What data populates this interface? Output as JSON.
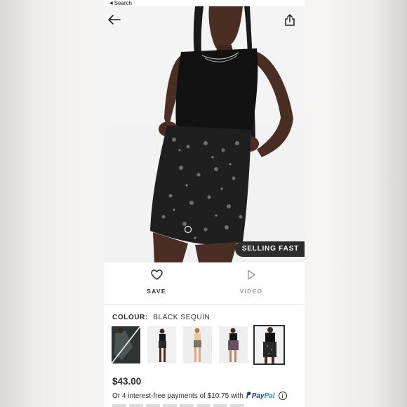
{
  "status": {
    "back_label": "Search",
    "back_icon": "triangle-left-icon"
  },
  "hero": {
    "badge": "SELLING FAST",
    "back_icon": "arrow-left-icon",
    "share_icon": "share-icon"
  },
  "actions": {
    "save_label": "SAVE",
    "save_icon": "heart-icon",
    "video_label": "VIDEO",
    "video_icon": "play-icon"
  },
  "colour": {
    "key": "COLOUR:",
    "value": "BLACK SEQUIN"
  },
  "thumbnails": [
    {
      "name": "thumb-1"
    },
    {
      "name": "thumb-2"
    },
    {
      "name": "thumb-3"
    },
    {
      "name": "thumb-4"
    },
    {
      "name": "thumb-5",
      "selected": true
    }
  ],
  "price": "$43.00",
  "paypal": {
    "text": "Or 4 interest-free payments of $10.75 with",
    "brand_pay": "Pay",
    "brand_pal": "Pal"
  },
  "colors": {
    "ink": "#2d2d2d",
    "muted": "#9a9a9a",
    "badge_bg": "#2d2d2d",
    "paypal_dark": "#1a3c8f",
    "paypal_light": "#2790d6"
  }
}
